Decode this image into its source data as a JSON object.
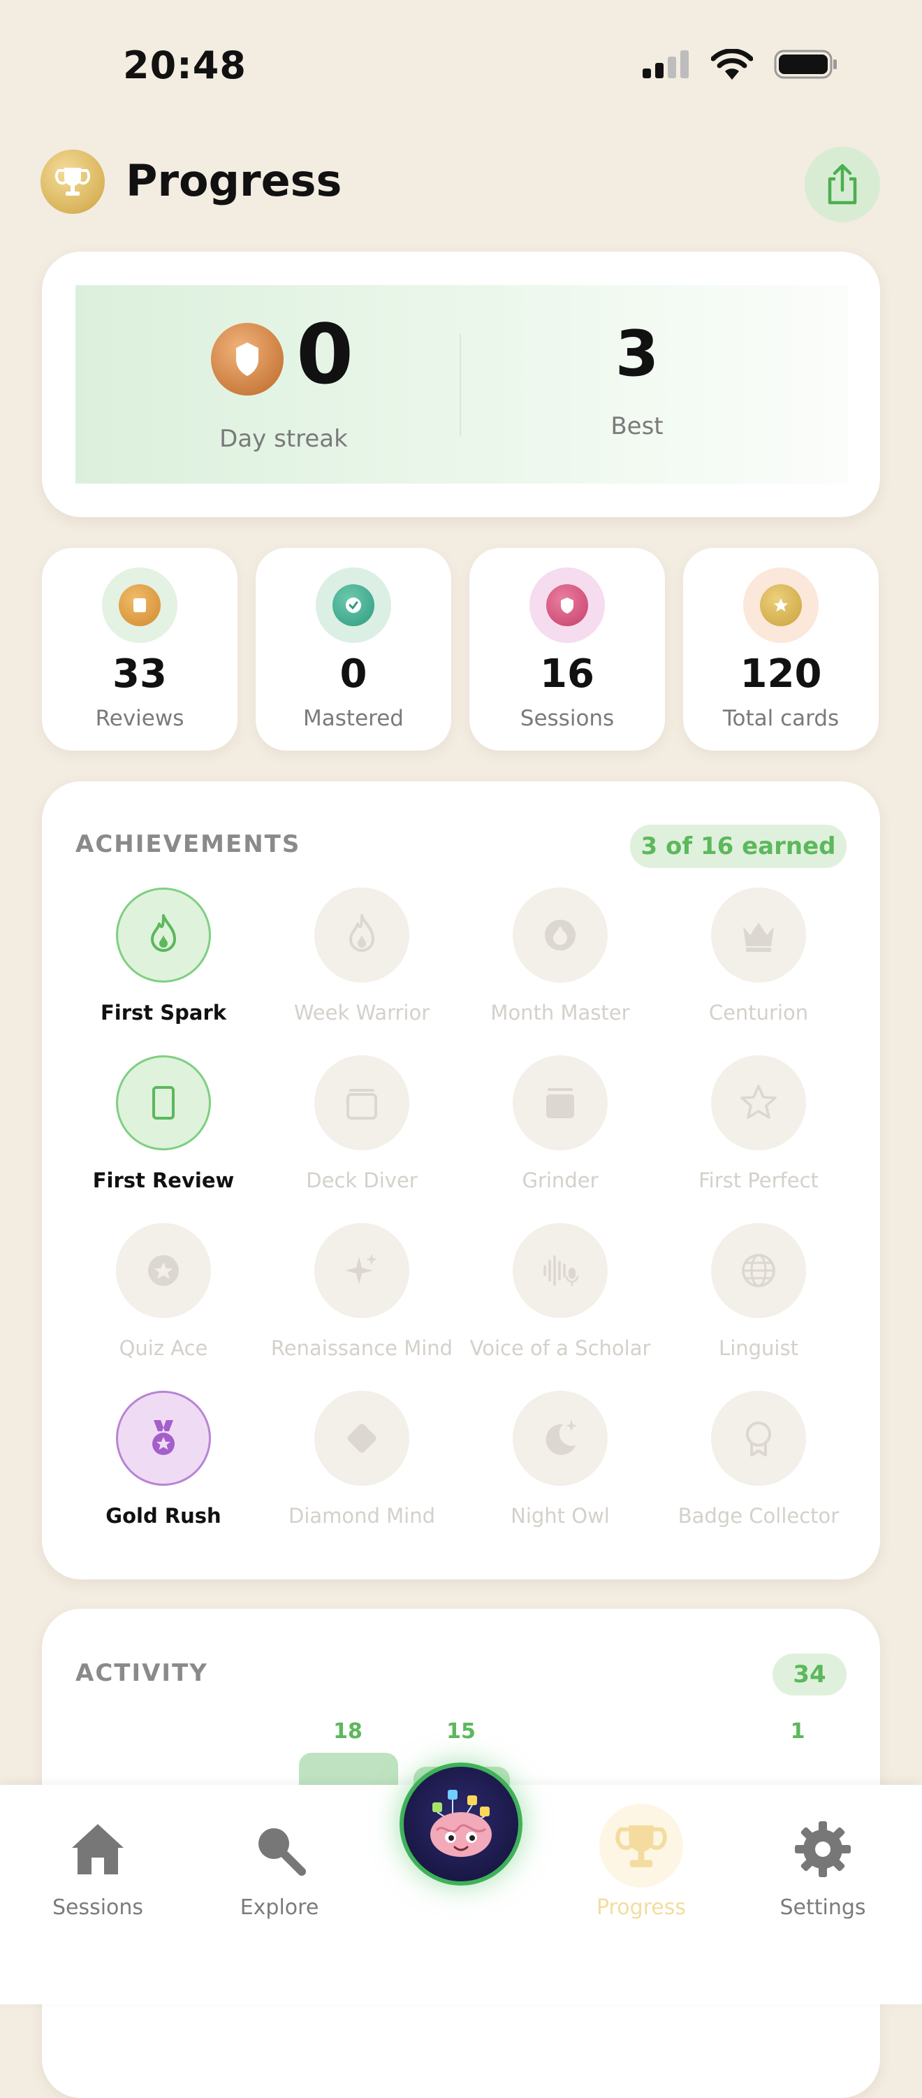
{
  "status": {
    "time": "20:48"
  },
  "header": {
    "title": "Progress",
    "trophy_icon": "trophy-icon",
    "share_icon": "share-icon"
  },
  "streak": {
    "value": "0",
    "label": "Day streak",
    "best_value": "3",
    "best_label": "Best"
  },
  "stats": [
    {
      "value": "33",
      "label": "Reviews",
      "icon": "cards-icon",
      "ring": "#e3f2e3",
      "coin": "#d99a3e"
    },
    {
      "value": "0",
      "label": "Mastered",
      "icon": "check-icon",
      "ring": "#dcefe5",
      "coin": "#3fa68c"
    },
    {
      "value": "16",
      "label": "Sessions",
      "icon": "shield-icon",
      "ring": "#f6dcef",
      "coin": "#d2507a"
    },
    {
      "value": "120",
      "label": "Total cards",
      "icon": "star-icon",
      "ring": "#fbe8da",
      "coin": "#d7b14e"
    }
  ],
  "achievements": {
    "title": "ACHIEVEMENTS",
    "earned_text": "3 of 16 earned",
    "items": [
      {
        "name": "First Spark",
        "icon": "flame-icon",
        "state": "earned"
      },
      {
        "name": "Week Warrior",
        "icon": "flame-icon",
        "state": "locked"
      },
      {
        "name": "Month Master",
        "icon": "flame-badge-icon",
        "state": "locked"
      },
      {
        "name": "Centurion",
        "icon": "crown-icon",
        "state": "locked"
      },
      {
        "name": "First Review",
        "icon": "card-icon",
        "state": "earned"
      },
      {
        "name": "Deck Diver",
        "icon": "stack-icon",
        "state": "locked"
      },
      {
        "name": "Grinder",
        "icon": "stack-filled-icon",
        "state": "locked"
      },
      {
        "name": "First Perfect",
        "icon": "star-outline-icon",
        "state": "locked"
      },
      {
        "name": "Quiz Ace",
        "icon": "star-circle-icon",
        "state": "locked"
      },
      {
        "name": "Renaissance Mind",
        "icon": "sparkles-icon",
        "state": "locked"
      },
      {
        "name": "Voice of a Scholar",
        "icon": "waveform-mic-icon",
        "state": "locked"
      },
      {
        "name": "Linguist",
        "icon": "globe-icon",
        "state": "locked"
      },
      {
        "name": "Gold Rush",
        "icon": "medal-icon",
        "state": "earned-purple"
      },
      {
        "name": "Diamond Mind",
        "icon": "diamond-icon",
        "state": "locked"
      },
      {
        "name": "Night Owl",
        "icon": "moon-stars-icon",
        "state": "locked"
      },
      {
        "name": "Badge Collector",
        "icon": "rosette-icon",
        "state": "locked"
      }
    ]
  },
  "activity": {
    "title": "ACTIVITY",
    "total": "34",
    "bars": [
      {
        "label": "18",
        "value": 18
      },
      {
        "label": "15",
        "value": 15
      },
      {
        "label": "1",
        "value": 1
      }
    ]
  },
  "tabs": [
    {
      "label": "Sessions",
      "icon": "house-icon",
      "active": false
    },
    {
      "label": "Explore",
      "icon": "magnifier-icon",
      "active": false
    },
    {
      "label": "Progress",
      "icon": "trophy-icon",
      "active": true
    },
    {
      "label": "Settings",
      "icon": "gear-icon",
      "active": false
    }
  ],
  "center_button": {
    "icon": "brain-mascot-icon"
  },
  "colors": {
    "accent_green": "#5cb85c",
    "background": "#f3ece1",
    "active_tab": "#f4dc9f"
  }
}
